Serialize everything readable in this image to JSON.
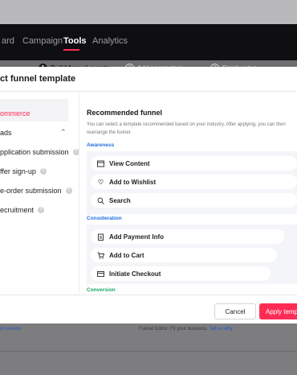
{
  "nav": {
    "items": [
      "ard",
      "Campaign",
      "Tools",
      "Analytics"
    ],
    "active_index": 2
  },
  "steps": [
    {
      "num": "1",
      "label": "Build funnel events",
      "state": "done"
    },
    {
      "num": "2",
      "label": "Add parameters",
      "state": "pending"
    },
    {
      "num": "3",
      "label": "Finish setup",
      "state": "pending"
    }
  ],
  "modal": {
    "title": "ct funnel template",
    "sidebar": [
      {
        "label": "ommerce",
        "active": true,
        "help": false,
        "chevron": false
      },
      {
        "label": "ads",
        "active": false,
        "help": false,
        "chevron": true
      },
      {
        "label": "pplication submission",
        "active": false,
        "help": true,
        "chevron": false
      },
      {
        "label": "ffer sign-up",
        "active": false,
        "help": true,
        "chevron": false
      },
      {
        "label": "e-order submission",
        "active": false,
        "help": true,
        "chevron": false
      },
      {
        "label": "ecruitment",
        "active": false,
        "help": true,
        "chevron": false
      }
    ],
    "recommended": {
      "title": "Recommended funnel",
      "description": "You can select a template recommended based on your industry. After applying, you can then rearrange the funnel."
    },
    "sections": [
      {
        "label": "Awareness",
        "color": "#1f6fde",
        "events": [
          {
            "label": "View Content",
            "icon": "view-content-icon"
          },
          {
            "label": "Add to Wishlist",
            "icon": "heart-icon"
          },
          {
            "label": "Search",
            "icon": "search-icon"
          }
        ]
      },
      {
        "label": "Consideration",
        "color": "#1f6fde",
        "events": [
          {
            "label": "Add Payment Info",
            "icon": "payment-info-icon"
          },
          {
            "label": "Add to Cart",
            "icon": "cart-icon"
          },
          {
            "label": "Initiate Checkout",
            "icon": "checkout-icon"
          }
        ]
      },
      {
        "label": "Conversion",
        "color": "#19a664",
        "events": []
      }
    ],
    "buttons": {
      "cancel": "Cancel",
      "apply": "Apply temp"
    }
  },
  "background_footer": {
    "left_link": "on events",
    "note": "Funnel Editor: Fit your business.",
    "note_link": "Tell us why"
  }
}
